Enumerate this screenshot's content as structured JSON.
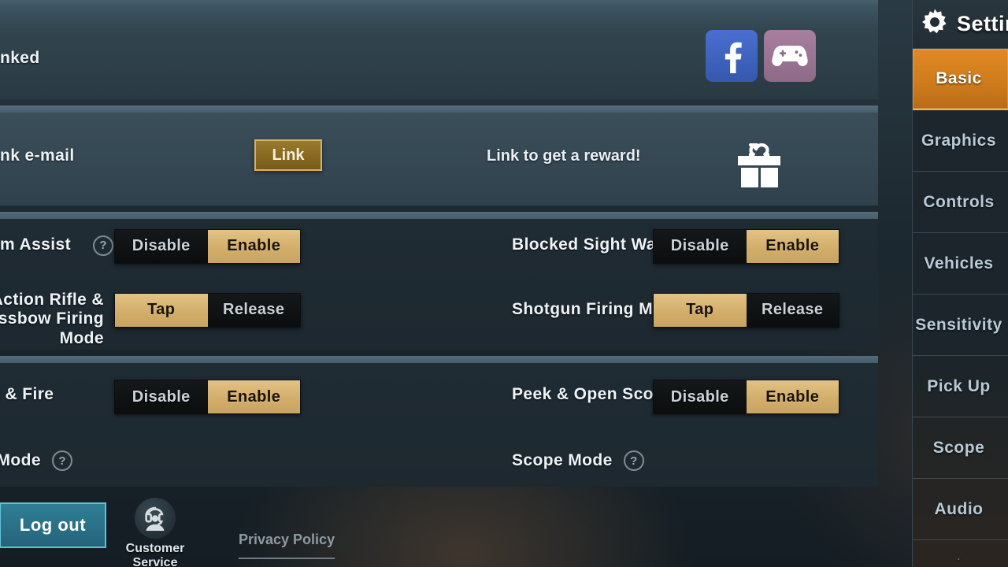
{
  "header": {
    "socials": [
      {
        "name": "facebook",
        "label": "f"
      },
      {
        "name": "game-controller",
        "label": ""
      }
    ],
    "linked_label": "nked"
  },
  "account": {
    "label": "nk e-mail",
    "link_button": "Link",
    "reward_text": "Link to get a reward!",
    "gift_icon": "gift-icon"
  },
  "settings_groups": [
    {
      "rows": [
        {
          "label": "m Assist",
          "has_help": true,
          "options": [
            "Disable",
            "Enable"
          ],
          "selected": "Enable"
        },
        {
          "label": "lt-Action Rifle &\nrossbow Firing Mode",
          "has_help": false,
          "options": [
            "Tap",
            "Release"
          ],
          "selected": "Tap"
        }
      ],
      "rows_right": [
        {
          "label": "Blocked Sight Warning",
          "has_help": false,
          "options": [
            "Disable",
            "Enable"
          ],
          "selected": "Enable"
        },
        {
          "label": "Shotgun Firing Mode",
          "has_help": false,
          "options": [
            "Tap",
            "Release"
          ],
          "selected": "Tap"
        }
      ]
    },
    {
      "rows": [
        {
          "label": "eek & Fire",
          "has_help": false,
          "options": [
            "Disable",
            "Enable"
          ],
          "selected": "Enable"
        },
        {
          "label": "an Mode",
          "has_help": true,
          "options": [],
          "selected": ""
        }
      ],
      "rows_right": [
        {
          "label": "Peek & Open Scope",
          "has_help": false,
          "options": [
            "Disable",
            "Enable"
          ],
          "selected": "Enable"
        },
        {
          "label": "Scope Mode",
          "has_help": true,
          "options": [],
          "selected": ""
        }
      ]
    }
  ],
  "footer": {
    "logout": "Log out",
    "customer_service": "Customer Service",
    "customer_service_icon": "headset-support-icon",
    "privacy_policy": "Privacy Policy"
  },
  "sidebar": {
    "title": "Settings",
    "gear_icon": "gear-icon",
    "items": [
      {
        "label": "Basic",
        "active": true
      },
      {
        "label": "Graphics",
        "active": false
      },
      {
        "label": "Controls",
        "active": false
      },
      {
        "label": "Vehicles",
        "active": false
      },
      {
        "label": "Sensitivity",
        "active": false
      },
      {
        "label": "Pick Up",
        "active": false
      },
      {
        "label": "Scope",
        "active": false
      },
      {
        "label": "Audio",
        "active": false
      }
    ],
    "tail_item": "."
  },
  "colors": {
    "accent_orange": "#cf7c1d",
    "toggle_on": "#d3ae6b",
    "toggle_off": "#0f1214",
    "logout_teal": "#2a7087",
    "link_gold": "#85671f"
  }
}
